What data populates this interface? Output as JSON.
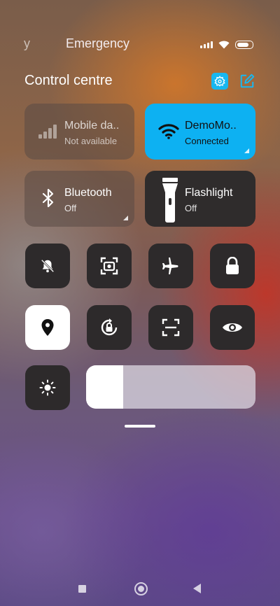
{
  "status_bar": {
    "left_fragment": "y",
    "center_text": "Emergency"
  },
  "control_centre": {
    "title": "Control centre",
    "settings_icon": "gear-icon",
    "edit_icon": "edit-icon"
  },
  "tiles": {
    "mobile_data": {
      "label": "Mobile da..",
      "status": "Not available",
      "icon": "signal-bars-icon"
    },
    "wifi": {
      "label": "DemoMo..",
      "status": "Connected",
      "icon": "wifi-icon",
      "color": "#0db1f2"
    },
    "bluetooth": {
      "label": "Bluetooth",
      "status": "Off",
      "icon": "bluetooth-icon"
    },
    "flashlight": {
      "label": "Flashlight",
      "status": "Off",
      "icon": "flashlight-icon"
    }
  },
  "toggles": [
    {
      "name": "silent",
      "icon": "bell-off-icon"
    },
    {
      "name": "screenshot",
      "icon": "screenshot-icon"
    },
    {
      "name": "airplane-mode",
      "icon": "airplane-icon"
    },
    {
      "name": "lock-screen",
      "icon": "lock-icon"
    },
    {
      "name": "location",
      "icon": "location-pin-icon",
      "active": true
    },
    {
      "name": "auto-rotate",
      "icon": "rotate-lock-icon"
    },
    {
      "name": "scanner",
      "icon": "scan-frame-icon"
    },
    {
      "name": "reading-mode",
      "icon": "eye-icon"
    }
  ],
  "brightness": {
    "icon": "sun-icon",
    "level_fraction": 0.22
  },
  "navigation": {
    "recents": "square-icon",
    "home": "circle-icon",
    "back": "triangle-back-icon"
  }
}
